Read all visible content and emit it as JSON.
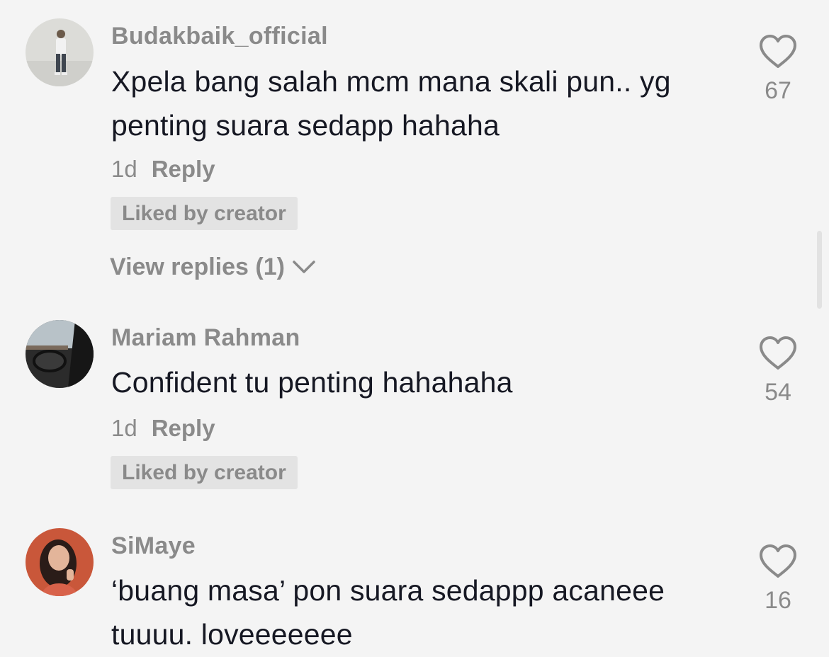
{
  "comments": [
    {
      "username": "Budakbaik_official",
      "text": "Xpela bang salah mcm mana skali pun.. yg penting suara sedapp hahaha",
      "time": "1d",
      "reply_label": "Reply",
      "badge": "Liked by creator",
      "view_replies": "View replies (1)",
      "likes": "67"
    },
    {
      "username": "Mariam Rahman",
      "text": "Confident tu penting hahahaha",
      "time": "1d",
      "reply_label": "Reply",
      "badge": "Liked by creator",
      "likes": "54"
    },
    {
      "username": "SiMaye",
      "text": "‘buang masa’ pon suara sedappp acaneee tuuuu. loveeeeeee",
      "likes": "16"
    }
  ]
}
